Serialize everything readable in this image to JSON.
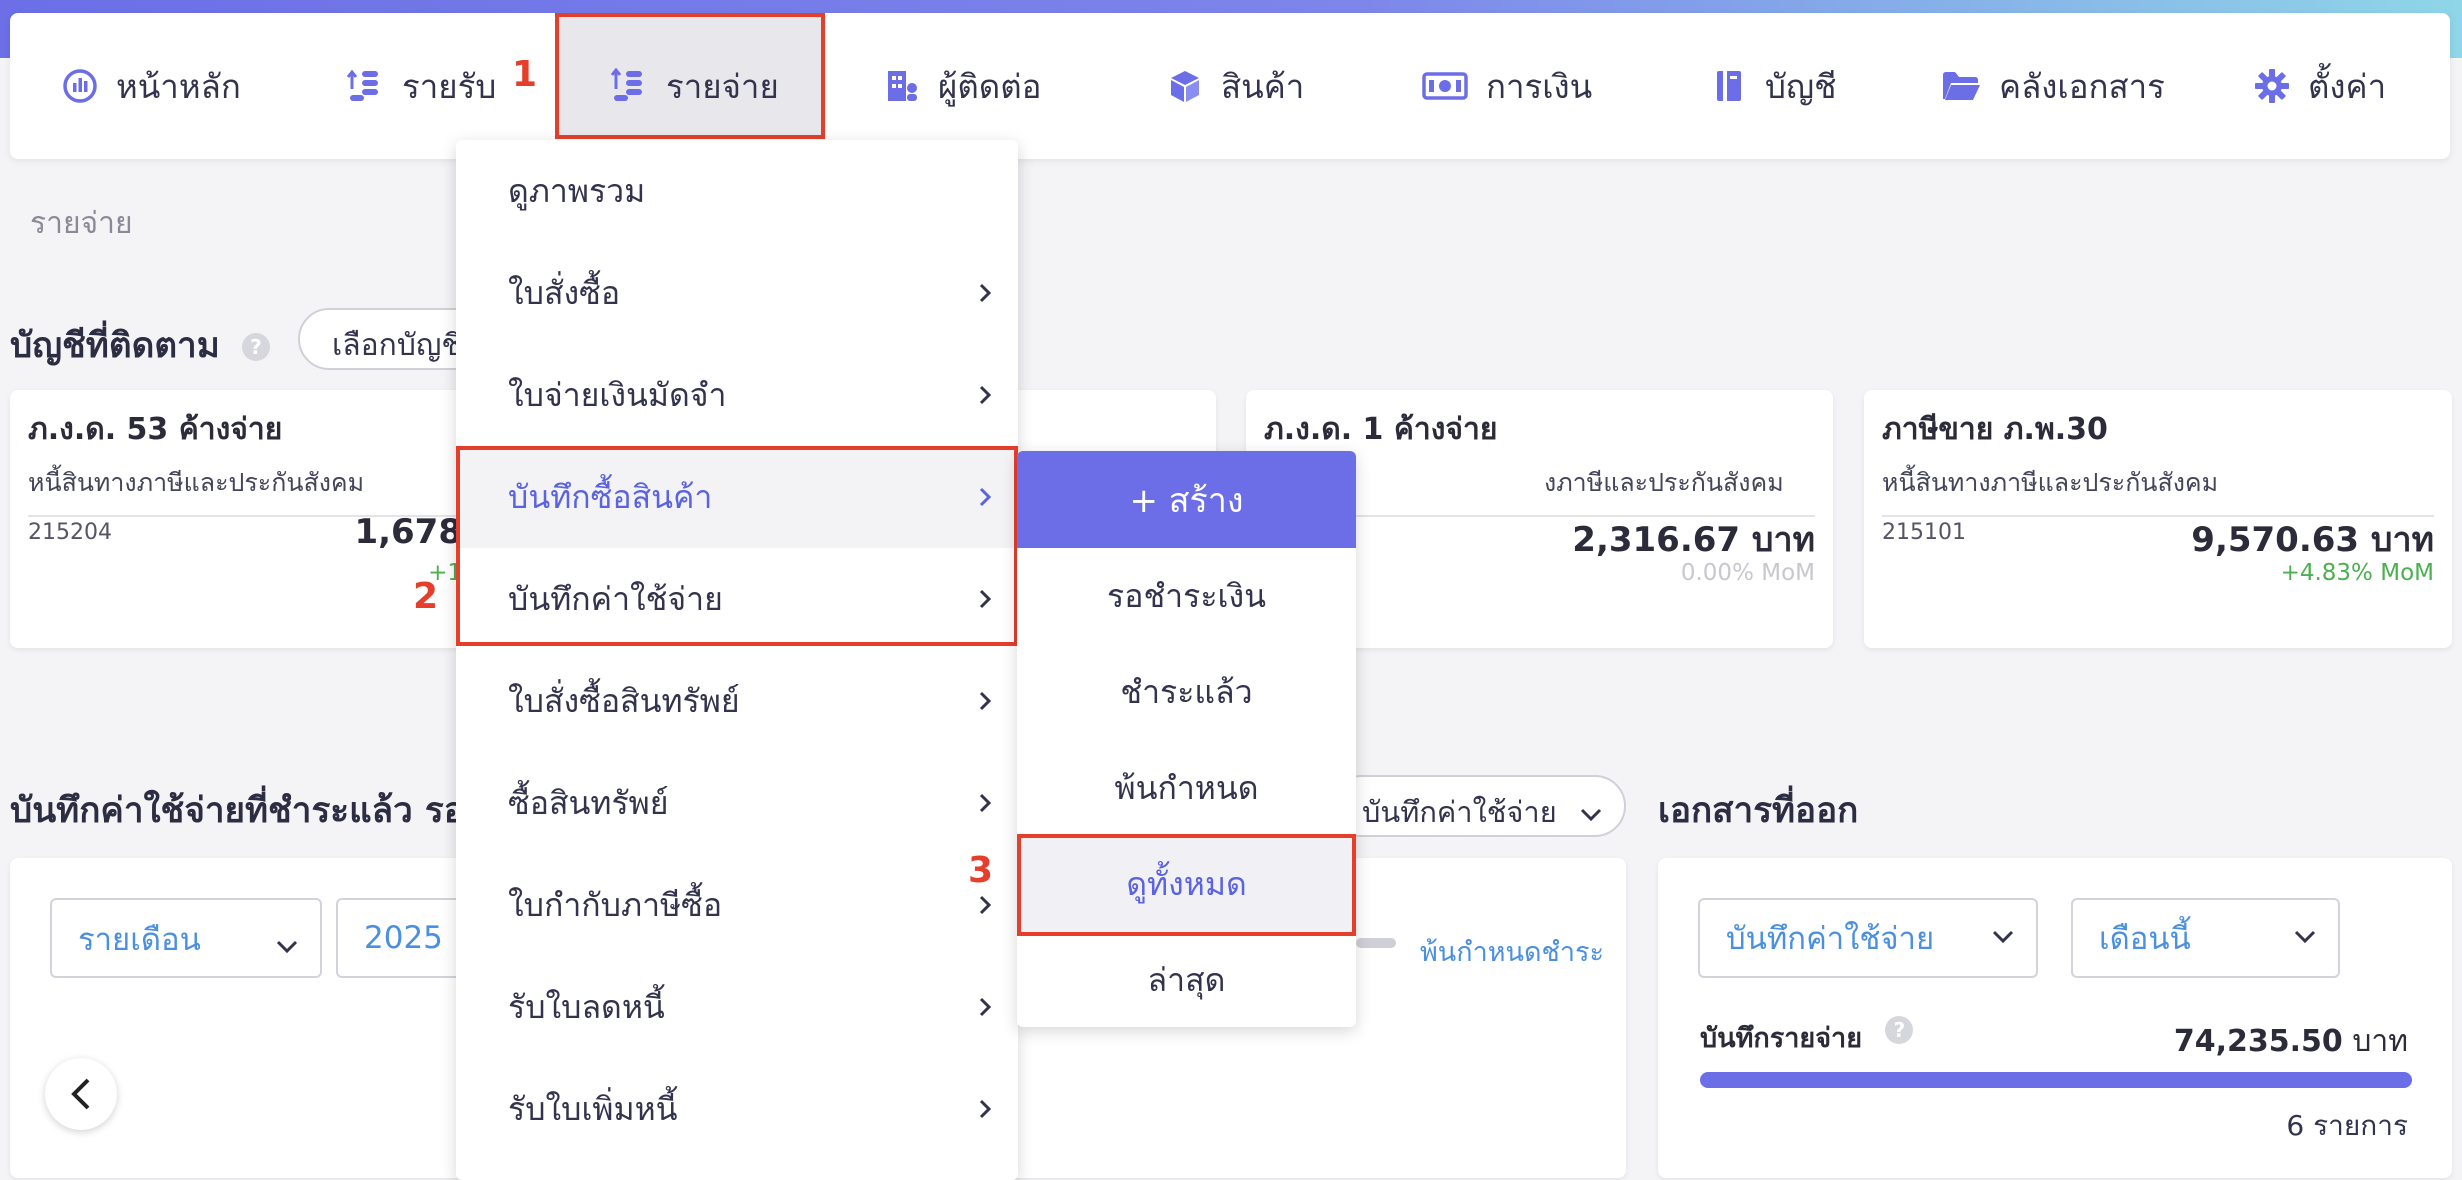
{
  "nav": {
    "items": [
      {
        "label": "หน้าหลัก",
        "icon": "chart-icon"
      },
      {
        "label": "รายรับ",
        "icon": "coins-up-icon"
      },
      {
        "label": "รายจ่าย",
        "icon": "coins-down-icon"
      },
      {
        "label": "ผู้ติดต่อ",
        "icon": "building-icon"
      },
      {
        "label": "สินค้า",
        "icon": "box-icon"
      },
      {
        "label": "การเงิน",
        "icon": "money-icon"
      },
      {
        "label": "บัญชี",
        "icon": "ledger-icon"
      },
      {
        "label": "คลังเอกสาร",
        "icon": "folder-icon"
      },
      {
        "label": "ตั้งค่า",
        "icon": "gear-icon"
      }
    ]
  },
  "breadcrumb": "รายจ่าย",
  "annotations": {
    "step1": "1",
    "step2": "2",
    "step3": "3"
  },
  "watch": {
    "title": "บัญชีที่ติดตาม",
    "help": "?",
    "select_label": "เลือกบัญชี",
    "cards": [
      {
        "title": "ภ.ง.ด. 53 ค้างจ่าย",
        "subtitle": "หนี้สินทางภาษีและประกันสังคม",
        "code": "215204",
        "amount": "1,678",
        "mom": "+1"
      },
      {
        "title": "ภ.ง.ด. 1 ค้างจ่าย",
        "subtitle": "งภาษีและประกันสังคม",
        "code": "",
        "amount": "2,316.67 บาท",
        "mom": "0.00% MoM"
      },
      {
        "title": "ภาษีขาย ภ.พ.30",
        "subtitle": "หนี้สินทางภาษีและประกันสังคม",
        "code": "215101",
        "amount": "9,570.63 บาท",
        "mom": "+4.83% MoM"
      }
    ]
  },
  "expenses_section": {
    "title": "บันทึกค่าใช้จ่ายที่ชำระแล้ว รอชำ",
    "doc_select": "บันทึกค่าใช้จ่าย",
    "period_select": "รายเดือน",
    "year_select": "2025",
    "legend_overdue": "พ้นกำหนดชำระ"
  },
  "issued_docs": {
    "title": "เอกสารที่ออก",
    "doc_select": "บันทึกค่าใช้จ่าย",
    "month_select": "เดือนนี้",
    "metric_label": "บันทึกรายจ่าย",
    "help": "?",
    "amount": "74,235.50",
    "unit": "บาท",
    "count": "6 รายการ",
    "bar_fill": 1.0
  },
  "dropdown": {
    "items": [
      {
        "label": "ดูภาพรวม",
        "has_arrow": false
      },
      {
        "label": "ใบสั่งซื้อ",
        "has_arrow": true
      },
      {
        "label": "ใบจ่ายเงินมัดจำ",
        "has_arrow": true
      },
      {
        "label": "บันทึกซื้อสินค้า",
        "has_arrow": true
      },
      {
        "label": "บันทึกค่าใช้จ่าย",
        "has_arrow": true
      },
      {
        "label": "ใบสั่งซื้อสินทรัพย์",
        "has_arrow": true
      },
      {
        "label": "ซื้อสินทรัพย์",
        "has_arrow": true
      },
      {
        "label": "ใบกำกับภาษีซื้อ",
        "has_arrow": true
      },
      {
        "label": "รับใบลดหนี้",
        "has_arrow": true
      },
      {
        "label": "รับใบเพิ่มหนี้",
        "has_arrow": true
      }
    ]
  },
  "submenu": {
    "create": "+ สร้าง",
    "items": [
      "รอชำระเงิน",
      "ชำระแล้ว",
      "พ้นกำหนด",
      "ดูทั้งหมด",
      "ล่าสุด"
    ]
  },
  "colors": {
    "accent": "#6b6ee6",
    "highlight": "#e53f2c",
    "positive": "#4caf50"
  }
}
